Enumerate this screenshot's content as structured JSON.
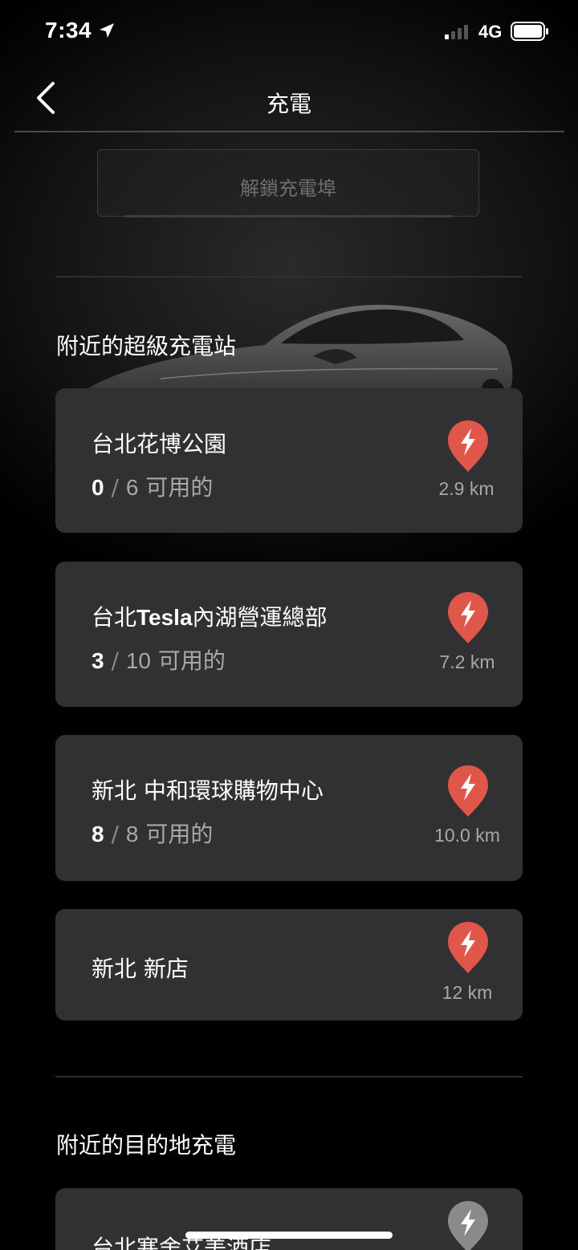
{
  "status_bar": {
    "time": "7:34",
    "network": "4G"
  },
  "nav": {
    "title": "充電"
  },
  "unlock_button": {
    "label": "解鎖充電埠"
  },
  "supercharger_section": {
    "heading": "附近的超級充電站",
    "stations": [
      {
        "name": "台北花博公園",
        "available": "0",
        "total": "6",
        "suffix": "可用的",
        "distance": "2.9 km",
        "pin_color": "#e0564a"
      },
      {
        "name_prefix": "台北",
        "name_bold": "Tesla",
        "name_suffix": "內湖營運總部",
        "available": "3",
        "total": "10",
        "suffix": "可用的",
        "distance": "7.2 km",
        "pin_color": "#e0564a"
      },
      {
        "name": "新北 中和環球購物中心",
        "available": "8",
        "total": "8",
        "suffix": "可用的",
        "distance": "10.0 km",
        "pin_color": "#e0564a"
      },
      {
        "name": "新北 新店",
        "distance": "12 km",
        "pin_color": "#e0564a"
      }
    ]
  },
  "destination_section": {
    "heading": "附近的目的地充電",
    "stations": [
      {
        "name": "台北寒舍艾美酒店",
        "pin_color": "#8a8a8d"
      }
    ]
  },
  "colors": {
    "card": "#313133",
    "accent_pin": "#e0564a",
    "muted_text": "#a8a8ab"
  }
}
